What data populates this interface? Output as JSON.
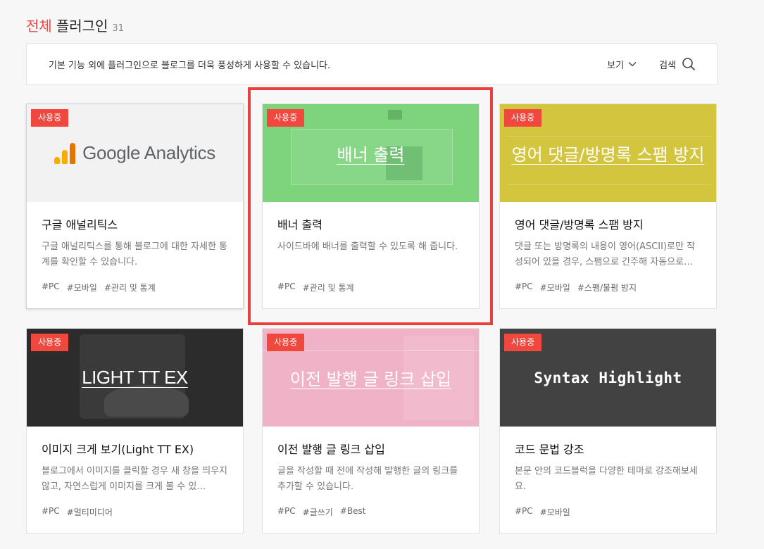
{
  "header": {
    "title_accent": "전체",
    "title_rest": "플러그인",
    "count": "31"
  },
  "info": {
    "description": "기본 기능 외에 플러그인으로 블로그를 더욱 풍성하게 사용할 수 있습니다.",
    "view_label": "보기",
    "search_label": "검색"
  },
  "colors": {
    "accent": "#f0483e",
    "highlight_box": "#ea3f3f"
  },
  "plugins": [
    {
      "badge": "사용중",
      "thumb_text": "Google Analytics",
      "title": "구글 애널리틱스",
      "desc": "구글 애널리틱스를 통해 블로그에 대한 자세한 통계를 확인할 수 있습니다.",
      "tags": [
        "#PC",
        "#모바일",
        "#관리 및 통계"
      ]
    },
    {
      "badge": "사용중",
      "thumb_text": "배너 출력",
      "title": "배너 출력",
      "desc": "사이드바에 배너를 출력할 수 있도록 해 줍니다.",
      "tags": [
        "#PC",
        "#관리 및 통계"
      ]
    },
    {
      "badge": "사용중",
      "thumb_text": "영어 댓글/방명록 스팸 방지",
      "title": "영어 댓글/방명록 스팸 방지",
      "desc": "댓글 또는 방명록의 내용이 영어(ASCII)로만 작성되어 있을 경우, 스팸으로 간주해 자동으로…",
      "tags": [
        "#PC",
        "#모바일",
        "#스팸/불펌 방지"
      ]
    },
    {
      "badge": "사용중",
      "thumb_text": "LIGHT TT EX",
      "title": "이미지 크게 보기(Light TT EX)",
      "desc": "블로그에서 이미지를 클릭할 경우 새 창을 띄우지 않고, 자연스럽게 이미지를 크게 볼 수 있…",
      "tags": [
        "#PC",
        "#멀티미디어"
      ]
    },
    {
      "badge": "사용중",
      "thumb_text": "이전 발행 글 링크 삽입",
      "title": "이전 발행 글 링크 삽입",
      "desc": "글을 작성할 때 전에 작성해 발행한 글의 링크를 추가할 수 있습니다.",
      "tags": [
        "#PC",
        "#글쓰기",
        "#Best"
      ]
    },
    {
      "badge": "사용중",
      "thumb_text": "Syntax Highlight",
      "title": "코드 문법 강조",
      "desc": "본문 안의 코드블럭을 다양한 테마로 강조해보세요.",
      "tags": [
        "#PC",
        "#모바일"
      ]
    }
  ]
}
